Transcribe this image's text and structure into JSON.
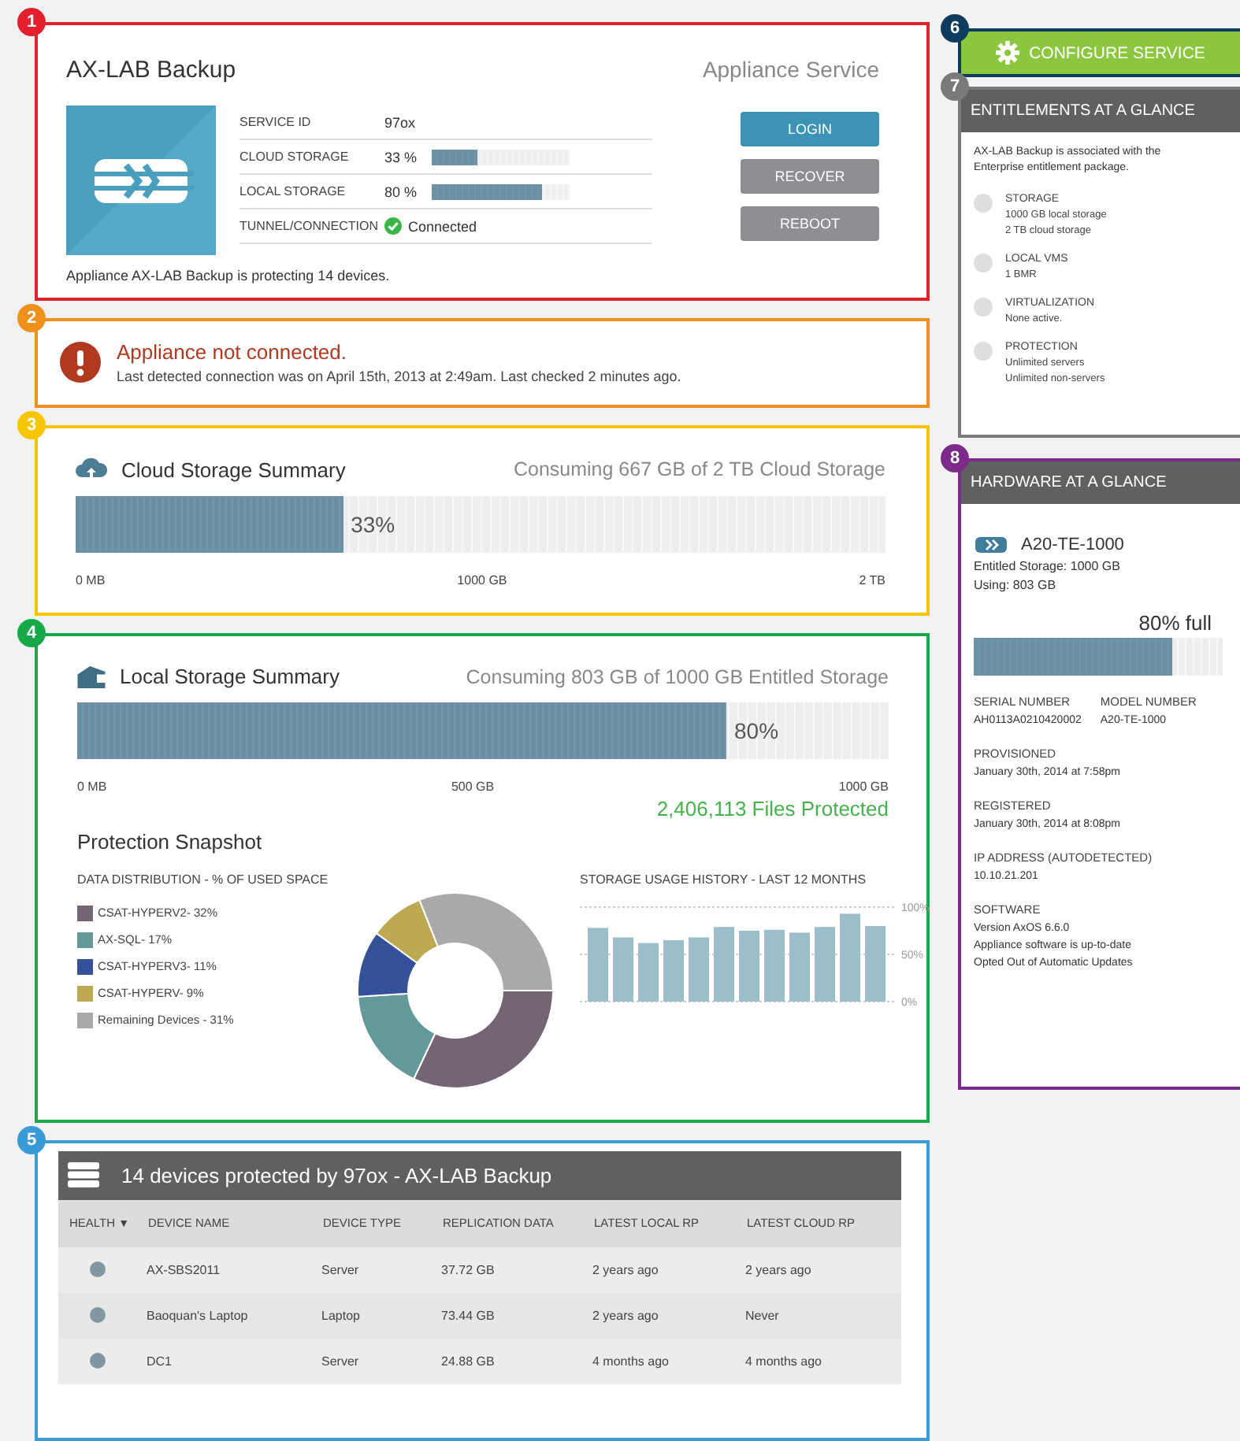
{
  "callouts": [
    {
      "number": "1",
      "color": "#e3202d"
    },
    {
      "number": "2",
      "color": "#f0901c"
    },
    {
      "number": "3",
      "color": "#f6c700"
    },
    {
      "number": "4",
      "color": "#17a84a"
    },
    {
      "number": "5",
      "color": "#3b9bd8"
    },
    {
      "number": "6",
      "color": "#0e3b5e"
    },
    {
      "number": "7",
      "color": "#7a7a7a"
    },
    {
      "number": "8",
      "color": "#7c2b8b"
    }
  ],
  "appliance": {
    "title": "AX-LAB Backup",
    "service_type": "Appliance Service",
    "rows": [
      {
        "kind": "text",
        "label": "SERVICE ID",
        "value": "97ox"
      },
      {
        "kind": "meter",
        "label": "CLOUD STORAGE",
        "value": "33 %",
        "level": 0.33
      },
      {
        "kind": "meter",
        "label": "LOCAL STORAGE",
        "value": "80 %",
        "level": 0.8
      },
      {
        "kind": "status",
        "label": "TUNNEL/CONNECTION",
        "value": "Connected"
      }
    ],
    "buttons": [
      {
        "label": "LOGIN",
        "kind": "primary"
      },
      {
        "label": "RECOVER",
        "kind": "secondary"
      },
      {
        "label": "REBOOT",
        "kind": "secondary"
      }
    ],
    "footer": "Appliance AX-LAB Backup is protecting 14 devices."
  },
  "alert": {
    "title": "Appliance not connected.",
    "message": "Last detected connection was on April 15th, 2013 at 2:49am. Last checked 2 minutes ago."
  },
  "cloud_summary": {
    "title": "Cloud Storage Summary",
    "consumption": "Consuming 667 GB of 2 TB Cloud Storage",
    "level": 0.33,
    "reading": "33%",
    "scale": [
      "0 MB",
      "1000 GB",
      "2 TB"
    ]
  },
  "local_summary": {
    "title": "Local Storage Summary",
    "consumption": "Consuming 803 GB of 1000 GB Entitled Storage",
    "level": 0.8,
    "reading": "80%",
    "scale": [
      "0 MB",
      "500 GB",
      "1000 GB"
    ],
    "files_protected": "2,406,113 Files Protected"
  },
  "snapshot": {
    "title": "Protection Snapshot",
    "distribution": {
      "heading": "DATA DISTRIBUTION - % OF USED SPACE",
      "legend": [
        {
          "label": "CSAT-HYPERV2- 32%",
          "color": "#756474"
        },
        {
          "label": "AX-SQL- 17%",
          "color": "#64999a"
        },
        {
          "label": "CSAT-HYPERV3- 11%",
          "color": "#34519a"
        },
        {
          "label": "CSAT-HYPERV- 9%",
          "color": "#bca951"
        },
        {
          "label": "Remaining Devices - 31%",
          "color": "#a9a9a9"
        }
      ],
      "chart_data": {
        "type": "donut",
        "values": [
          32,
          17,
          11,
          9,
          31
        ]
      }
    },
    "history": {
      "heading": "STORAGE USAGE HISTORY - LAST 12 MONTHS",
      "chart_data": {
        "type": "bar",
        "values": [
          78,
          68,
          62,
          65,
          68,
          79,
          75,
          76,
          73,
          79,
          93,
          80
        ],
        "ylim": [
          0,
          100
        ],
        "yticks": [
          {
            "value": 0,
            "label": "0%"
          },
          {
            "value": 50,
            "label": "50%"
          },
          {
            "value": 100,
            "label": "100%"
          }
        ]
      }
    }
  },
  "devices": {
    "title": "14 devices protected by 97ox - AX-LAB Backup",
    "sort_indicator": "▼",
    "health_column": "HEALTH",
    "columns": [
      "DEVICE NAME",
      "DEVICE TYPE",
      "REPLICATION DATA",
      "LATEST LOCAL RP",
      "LATEST CLOUD RP"
    ],
    "rows": [
      {
        "cells": [
          "AX-SBS2011",
          "Server",
          "37.72 GB",
          "2 years ago",
          "2 years ago"
        ]
      },
      {
        "cells": [
          "Baoquan's Laptop",
          "Laptop",
          "73.44 GB",
          "2 years ago",
          "Never"
        ]
      },
      {
        "cells": [
          "DC1",
          "Server",
          "24.88 GB",
          "4 months ago",
          "4 months ago"
        ]
      }
    ]
  },
  "configure_button": "CONFIGURE SERVICE",
  "entitlements": {
    "title": "ENTITLEMENTS AT A GLANCE",
    "intro": "AX-LAB Backup is associated with the Enterprise entitlement package.",
    "items": [
      {
        "name": "STORAGE",
        "details": [
          "1000 GB local storage",
          "2 TB cloud storage"
        ]
      },
      {
        "name": "LOCAL VMS",
        "details": [
          "1 BMR"
        ]
      },
      {
        "name": "VIRTUALIZATION",
        "details": [
          "None active."
        ]
      },
      {
        "name": "PROTECTION",
        "details": [
          "Unlimited servers",
          "Unlimited non-servers"
        ]
      }
    ]
  },
  "hardware": {
    "title": "HARDWARE AT A GLANCE",
    "model": "A20-TE-1000",
    "entitled": "Entitled Storage: 1000 GB",
    "using": "Using: 803 GB",
    "reading": "80% full",
    "level": 0.8,
    "pairs": [
      {
        "label": "SERIAL NUMBER",
        "value": "AH0113A0210420002"
      },
      {
        "label": "MODEL NUMBER",
        "value": "A20-TE-1000"
      }
    ],
    "fields": [
      {
        "label": "PROVISIONED",
        "lines": [
          "January 30th, 2014 at 7:58pm"
        ]
      },
      {
        "label": "REGISTERED",
        "lines": [
          "January 30th, 2014 at 8:08pm"
        ]
      },
      {
        "label": "IP ADDRESS (AUTODETECTED)",
        "lines": [
          "10.10.21.201"
        ]
      },
      {
        "label": "SOFTWARE",
        "lines": [
          "Version AxOS 6.6.0",
          "Appliance software is up-to-date",
          "Opted Out of Automatic Updates"
        ]
      }
    ]
  }
}
